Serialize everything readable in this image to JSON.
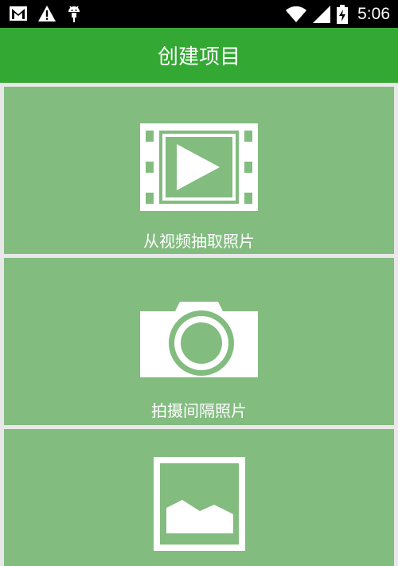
{
  "status_bar": {
    "icons": [
      "gmail-icon",
      "warning-icon",
      "android-debug-icon",
      "wifi-icon",
      "signal-icon",
      "battery-charging-icon"
    ],
    "time": "5:06"
  },
  "app_bar": {
    "title": "创建项目"
  },
  "menu": {
    "items": [
      {
        "icon": "video-film-icon",
        "label": "从视频抽取照片"
      },
      {
        "icon": "camera-icon",
        "label": "拍摄间隔照片"
      },
      {
        "icon": "gallery-image-icon",
        "label": ""
      }
    ]
  },
  "colors": {
    "status_bar": "#000000",
    "app_bar": "#33a832",
    "tile": "#82bc7f",
    "divider": "#e8e8e8",
    "icon": "#ffffff"
  }
}
